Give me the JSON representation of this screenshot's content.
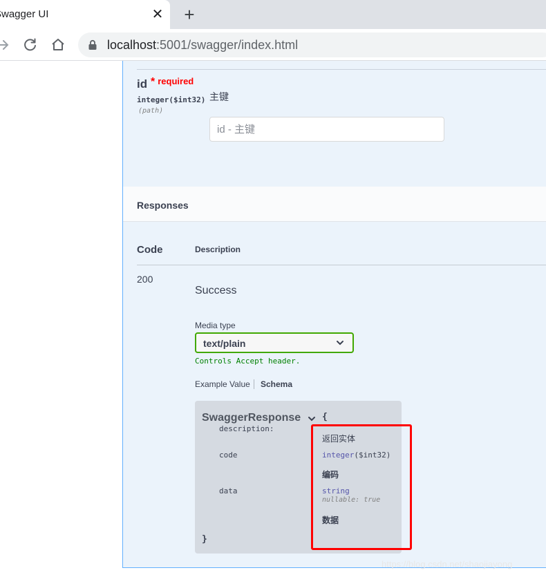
{
  "browser": {
    "tab_title": "Swagger UI",
    "close_glyph": "✕",
    "new_tab_glyph": "+",
    "url_host": "localhost",
    "url_rest": ":5001/swagger/index.html",
    "icons": [
      "forward-icon",
      "reload-icon",
      "home-icon",
      "lock-icon"
    ]
  },
  "parameter": {
    "name": "id",
    "required_star": "*",
    "required_label": "required",
    "type_text": "integer",
    "type_format": "($int32)",
    "location": "(path)",
    "description": "主键",
    "placeholder": "id - 主键"
  },
  "responses": {
    "title": "Responses",
    "col_code": "Code",
    "col_description": "Description",
    "rows": [
      {
        "code": "200",
        "description": "Success",
        "media_type_label": "Media type",
        "media_type_value": "text/plain",
        "media_hint": "Controls Accept header.",
        "tab_example": "Example Value",
        "tab_schema": "Schema"
      }
    ]
  },
  "schema": {
    "model_name": "SwaggerResponse",
    "open_brace": "{",
    "close_brace": "}",
    "properties": [
      {
        "name": "description:",
        "description": "返回实体"
      },
      {
        "name": "code",
        "type": "integer",
        "format": "($int32)",
        "description": "编码"
      },
      {
        "name": "data",
        "type": "string",
        "nullable_label": "nullable:",
        "nullable_value": "true",
        "description": "数据"
      }
    ]
  },
  "colors": {
    "accent": "#61affe",
    "highlight": "#ff0000",
    "select_border": "#41a800",
    "panel_bg": "#ebf3fb"
  },
  "watermark": "https://blog.csdn.net/shaojiayong"
}
